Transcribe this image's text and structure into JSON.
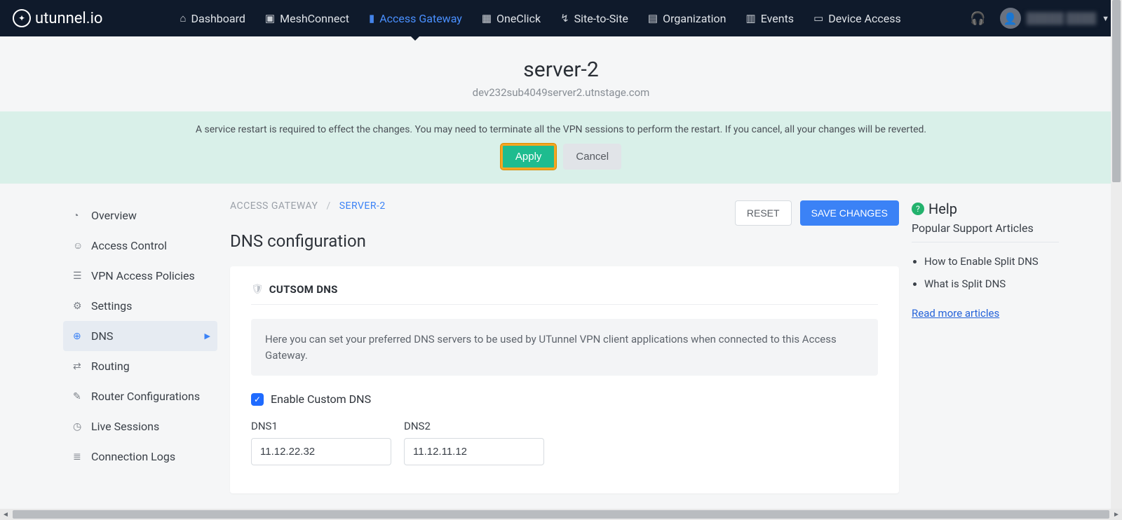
{
  "brand": "utunnel.io",
  "nav": [
    {
      "label": "Dashboard",
      "icon": "⌂"
    },
    {
      "label": "MeshConnect",
      "icon": "▣"
    },
    {
      "label": "Access Gateway",
      "icon": "▮",
      "active": true
    },
    {
      "label": "OneClick",
      "icon": "▦"
    },
    {
      "label": "Site-to-Site",
      "icon": "↯"
    },
    {
      "label": "Organization",
      "icon": "▤"
    },
    {
      "label": "Events",
      "icon": "▥"
    },
    {
      "label": "Device Access",
      "icon": "▭"
    }
  ],
  "user": {
    "name": "█████ ████"
  },
  "header": {
    "title": "server-2",
    "subtitle": "dev232sub4049server2.utnstage.com"
  },
  "notice": {
    "text": "A service restart is required to effect the changes. You may need to terminate all the VPN sessions to perform the restart. If you cancel, all your changes will be reverted.",
    "apply": "Apply",
    "cancel": "Cancel"
  },
  "sidebar": [
    {
      "label": "Overview",
      "icon": "◔"
    },
    {
      "label": "Access Control",
      "icon": "☺"
    },
    {
      "label": "VPN Access Policies",
      "icon": "☰"
    },
    {
      "label": "Settings",
      "icon": "⚙"
    },
    {
      "label": "DNS",
      "icon": "⊕",
      "active": true
    },
    {
      "label": "Routing",
      "icon": "⇄"
    },
    {
      "label": "Router Configurations",
      "icon": "✎"
    },
    {
      "label": "Live Sessions",
      "icon": "◷"
    },
    {
      "label": "Connection Logs",
      "icon": "≣"
    }
  ],
  "breadcrumb": {
    "root": "ACCESS GATEWAY",
    "current": "SERVER-2"
  },
  "buttons": {
    "reset": "RESET",
    "save": "SAVE CHANGES"
  },
  "section": {
    "title": "DNS configuration",
    "card_title": "CUTSOM DNS",
    "info": "Here you can set your preferred DNS servers to be used by UTunnel VPN client applications when connected to this Access Gateway.",
    "enable_label": "Enable Custom DNS",
    "dns1_label": "DNS1",
    "dns1_value": "11.12.22.32",
    "dns2_label": "DNS2",
    "dns2_value": "11.12.11.12"
  },
  "help": {
    "title": "Help",
    "subtitle": "Popular Support Articles",
    "articles": [
      "How to Enable Split DNS",
      "What is Split DNS"
    ],
    "more": "Read more articles"
  }
}
